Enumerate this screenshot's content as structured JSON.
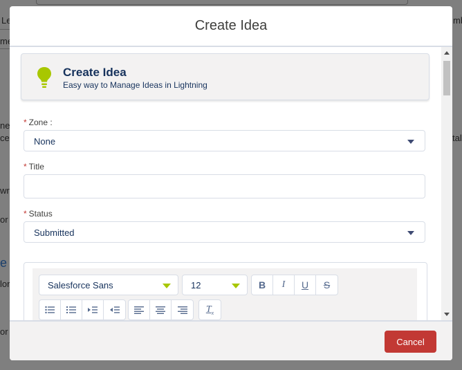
{
  "background": {
    "tab_fragment": "Le",
    "tab_fragment_right": "mbe",
    "text_frag_1": "me",
    "text_frag_2": "ne,",
    "text_frag_3": "cel",
    "text_frag_4": "wr",
    "text_frag_5": "or",
    "text_frag_6": "e",
    "text_frag_7": "lor",
    "text_frag_8": "or",
    "text_frag_right": "tal"
  },
  "modal": {
    "title": "Create Idea",
    "card": {
      "icon": "lightbulb-icon",
      "icon_color": "#a8c700",
      "title": "Create Idea",
      "subtitle": "Easy way to Manage Ideas in Lightning"
    },
    "fields": {
      "zone": {
        "label": "Zone :",
        "value": "None",
        "required": "*"
      },
      "title": {
        "label": "Title",
        "value": "",
        "required": "*"
      },
      "status": {
        "label": "Status",
        "value": "Submitted",
        "required": "*"
      }
    },
    "editor": {
      "font_family": "Salesforce Sans",
      "font_size": "12",
      "format_buttons": [
        "bold-icon",
        "italic-icon",
        "underline-icon",
        "strikethrough-icon"
      ],
      "list_buttons": [
        "bullet-list-icon",
        "numbered-list-icon",
        "indent-icon",
        "outdent-icon"
      ],
      "align_buttons": [
        "align-left-icon",
        "align-center-icon",
        "align-right-icon"
      ],
      "clear_button": "clear-format-icon"
    },
    "footer": {
      "cancel_label": "Cancel"
    }
  },
  "colors": {
    "brand_accent": "#a8c700",
    "destructive": "#c23934",
    "text_primary": "#16325c"
  }
}
